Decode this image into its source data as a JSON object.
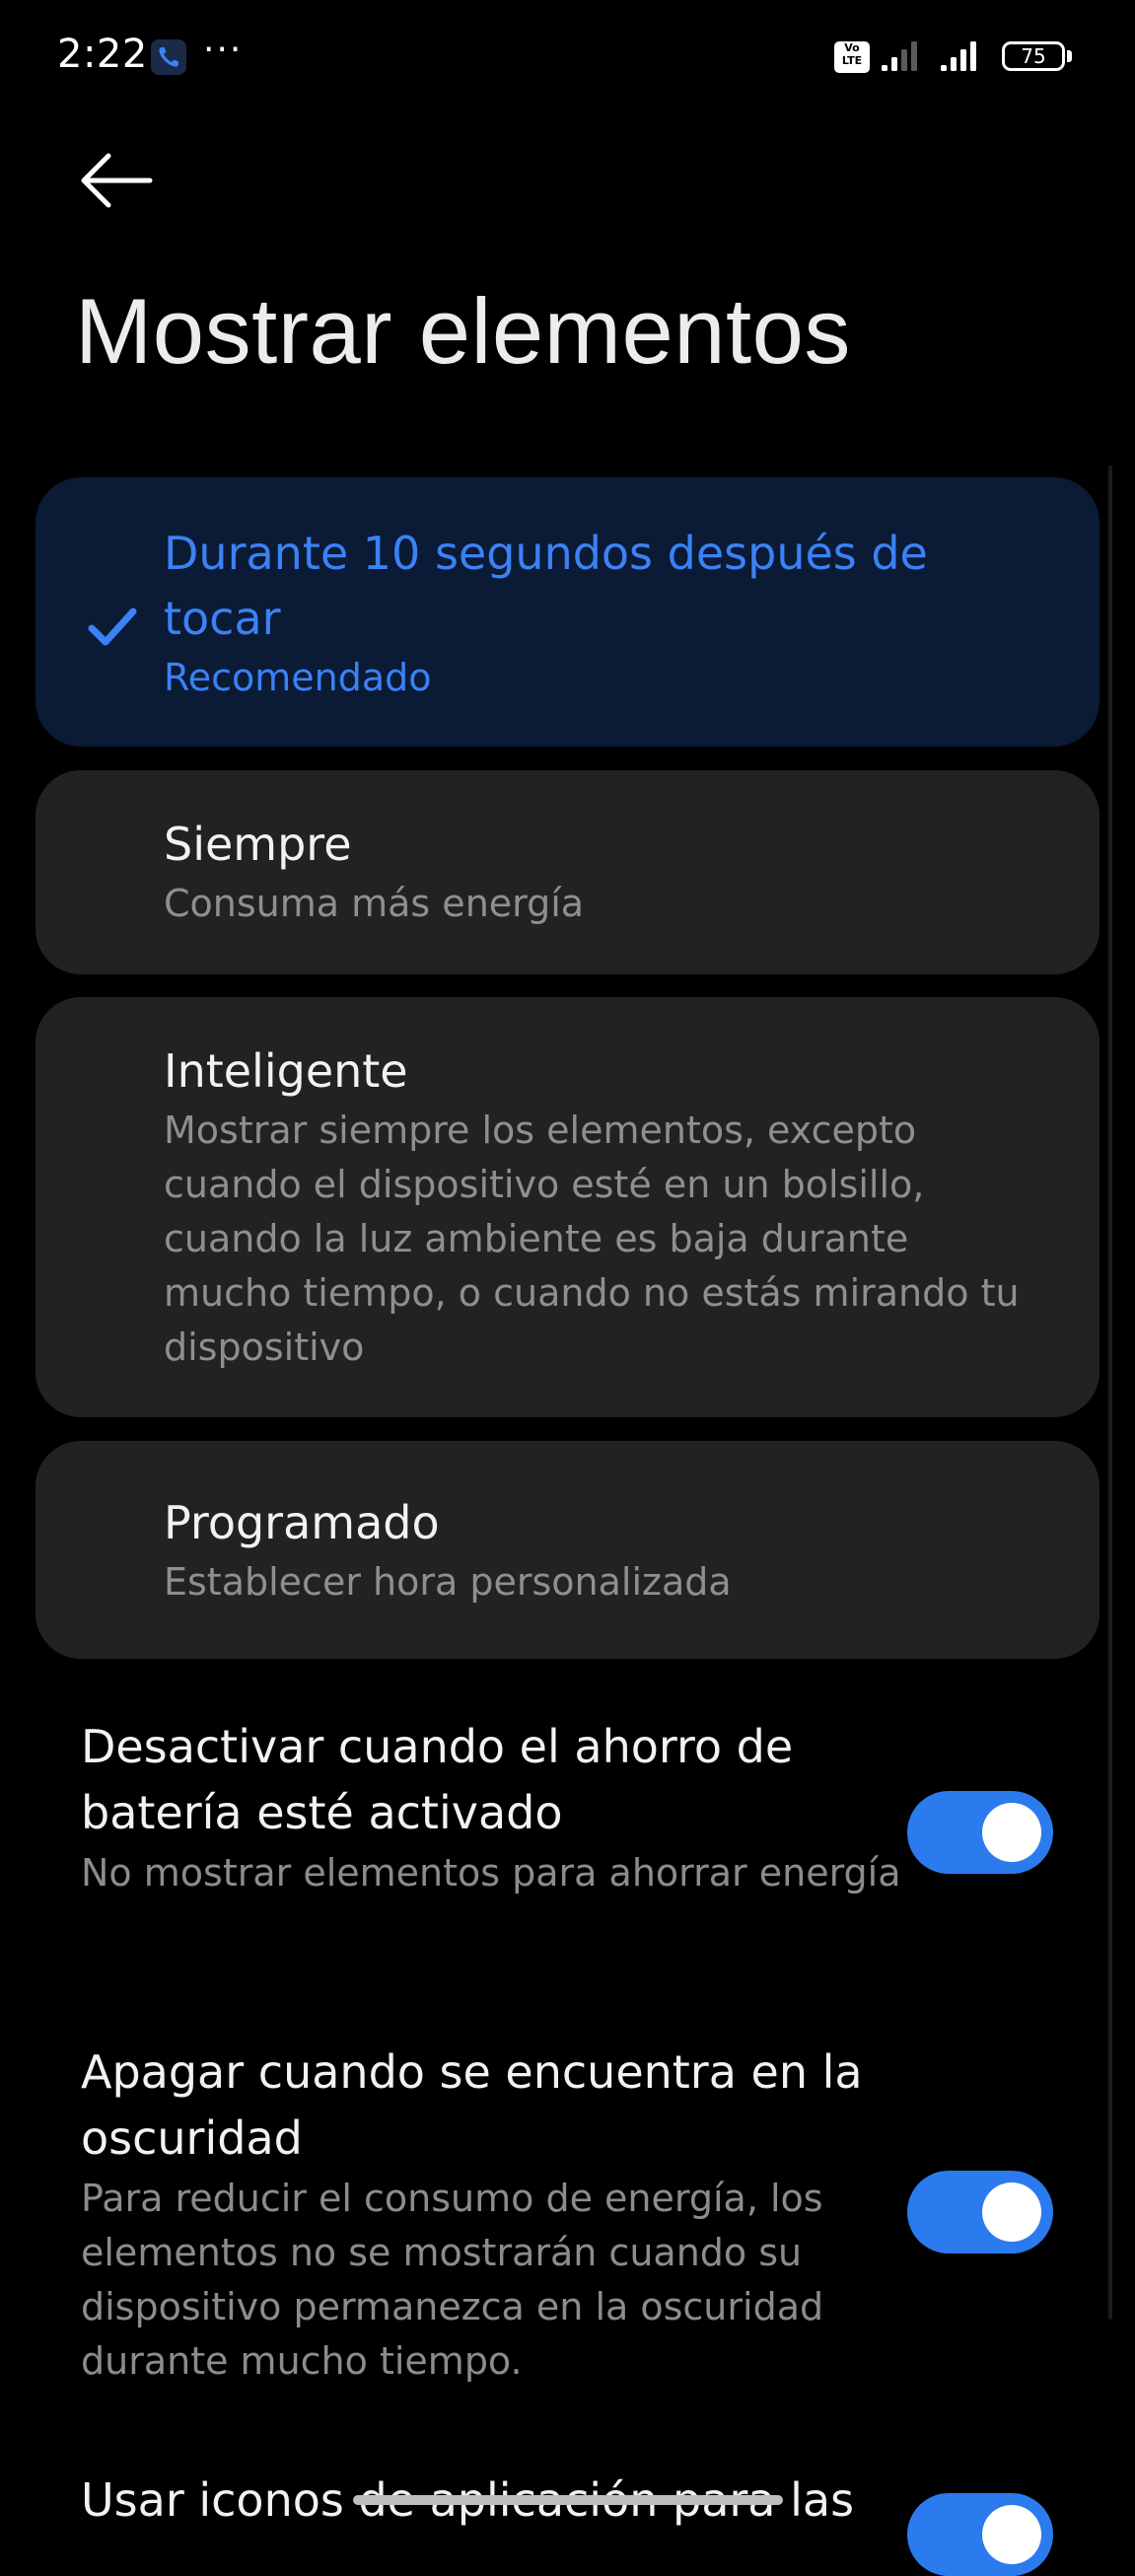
{
  "status_bar": {
    "time": "2:22",
    "dots": "···",
    "volte_top": "Vo",
    "volte_bottom": "LTE",
    "battery_level": "75"
  },
  "header": {
    "title": "Mostrar elementos"
  },
  "options": [
    {
      "title": "Durante 10 segundos después de tocar",
      "subtitle": "Recomendado",
      "selected": true
    },
    {
      "title": "Siempre",
      "subtitle": "Consuma más energía",
      "selected": false
    },
    {
      "title": "Inteligente",
      "subtitle": "Mostrar siempre los elementos, excepto cuando el dispositivo esté en un bolsillo, cuando la luz ambiente es baja durante mucho tiempo, o cuando no estás mirando tu dispositivo",
      "selected": false
    },
    {
      "title": "Programado",
      "subtitle": "Establecer hora personalizada",
      "selected": false
    }
  ],
  "settings": [
    {
      "title": "Desactivar cuando el ahorro de batería esté activado",
      "description": "No mostrar elementos para ahorrar energía",
      "enabled": true
    },
    {
      "title": "Apagar cuando se encuentra en la oscuridad",
      "description": "Para reducir el consumo de energía, los elementos no se mostrarán cuando su dispositivo permanezca en la oscuridad durante mucho tiempo.",
      "enabled": true
    },
    {
      "title": "Usar iconos de aplicación para las",
      "description": "",
      "enabled": true
    }
  ],
  "colors": {
    "accent": "#2b7bef",
    "selected_text": "#3a82f5",
    "selected_card": "#0b1a35",
    "card": "#222222",
    "background": "#000000"
  }
}
